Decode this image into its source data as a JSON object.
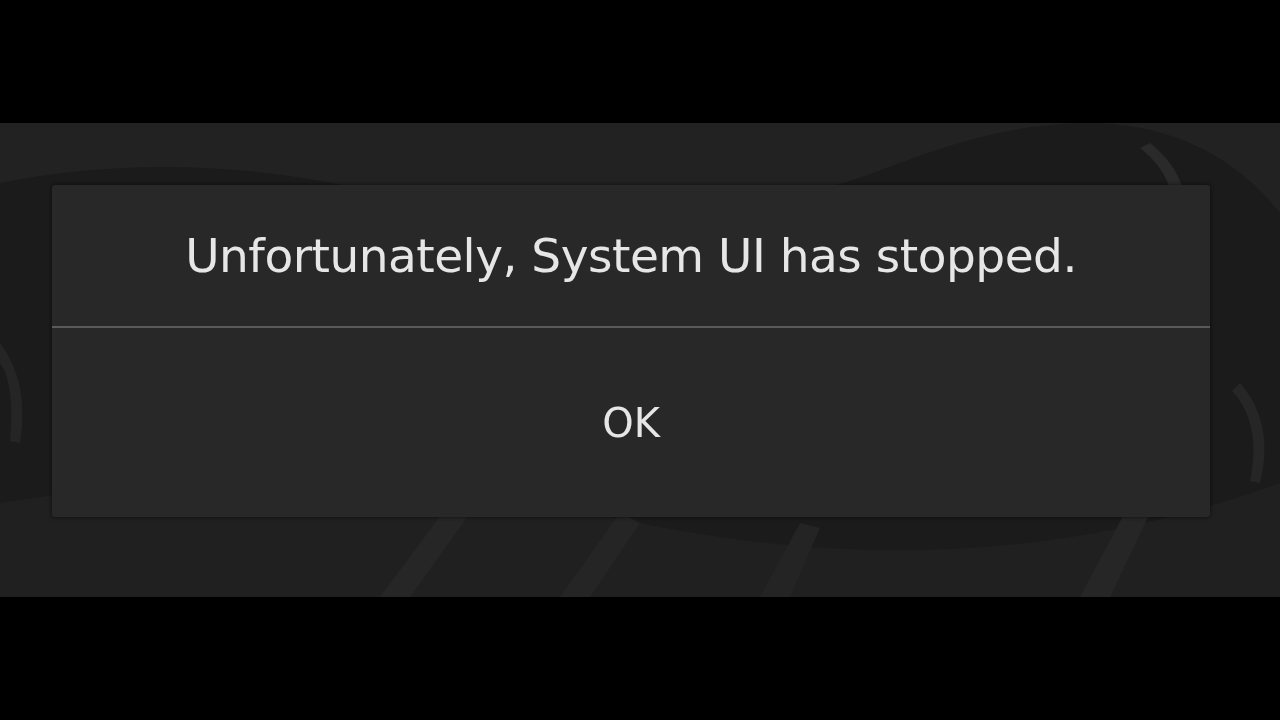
{
  "dialog": {
    "message": "Unfortunately, System UI has stopped.",
    "buttons": [
      {
        "label": "OK"
      }
    ]
  }
}
